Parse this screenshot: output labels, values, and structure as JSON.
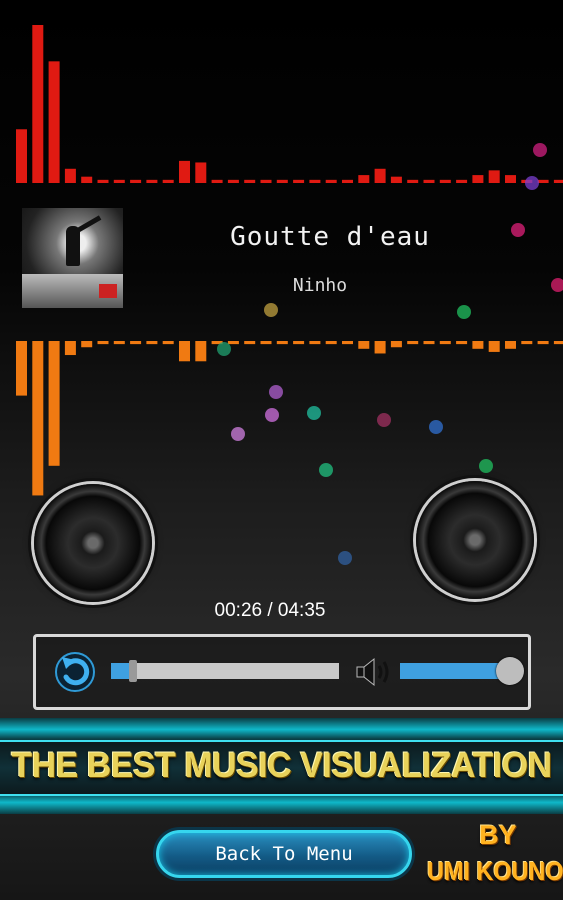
{
  "now_playing": {
    "title": "Goutte d'eau",
    "artist": "Ninho"
  },
  "playback": {
    "time_text": "00:26 / 04:35",
    "progress": 0.095,
    "volume": 1.0
  },
  "banner": {
    "text": "THE BEST MUSIC VISUALIZATION"
  },
  "menu": {
    "back_label": "Back To Menu"
  },
  "credit": {
    "by": "BY",
    "name": "UMI KOUNO"
  },
  "icons": {
    "repeat": "repeat-icon",
    "volume": "volume-icon"
  },
  "visualizer": {
    "top_color": "#e01a12",
    "bottom_color": "#f07a12",
    "top_levels": [
      0.34,
      1.0,
      0.77,
      0.09,
      0.04,
      0.02,
      0.02,
      0.02,
      0.02,
      0.02,
      0.14,
      0.13,
      0.02,
      0.02,
      0.02,
      0.02,
      0.02,
      0.02,
      0.02,
      0.02,
      0.02,
      0.05,
      0.09,
      0.04,
      0.02,
      0.02,
      0.02,
      0.02,
      0.05,
      0.08,
      0.05,
      0.02,
      0.02,
      0.02
    ],
    "bottom_levels": [
      0.35,
      0.99,
      0.8,
      0.09,
      0.04,
      0.02,
      0.02,
      0.02,
      0.02,
      0.02,
      0.13,
      0.13,
      0.02,
      0.02,
      0.02,
      0.02,
      0.02,
      0.02,
      0.02,
      0.02,
      0.02,
      0.05,
      0.08,
      0.04,
      0.02,
      0.02,
      0.02,
      0.02,
      0.05,
      0.07,
      0.05,
      0.02,
      0.02,
      0.02
    ]
  },
  "accent_color": "#3fa0e0"
}
